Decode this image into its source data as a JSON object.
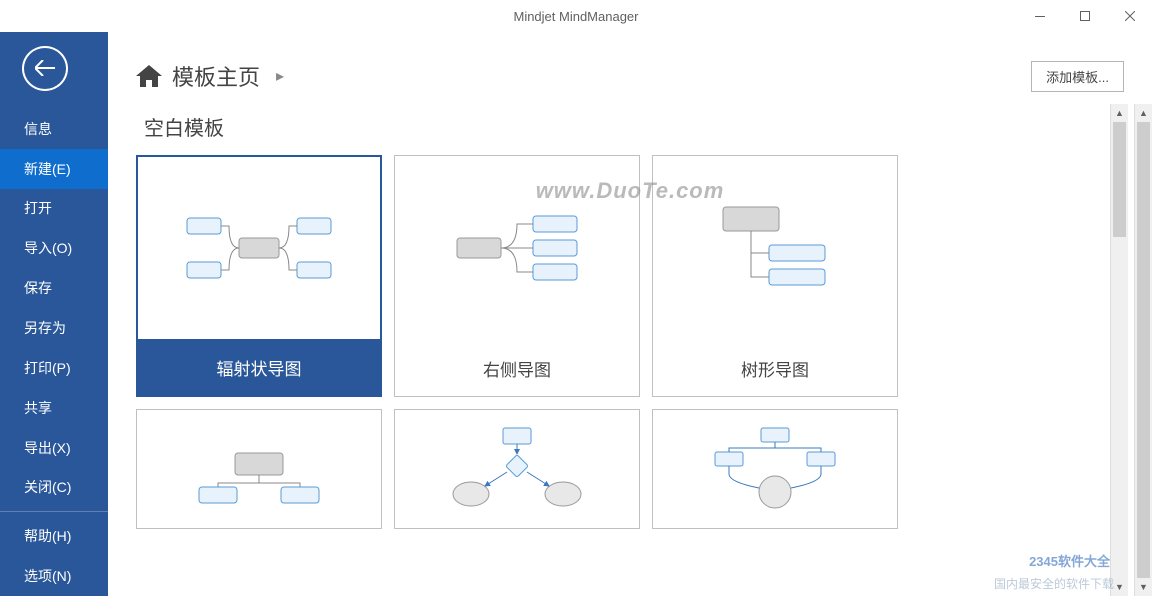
{
  "window": {
    "title": "Mindjet MindManager"
  },
  "sidebar": {
    "items": [
      {
        "label": "信息"
      },
      {
        "label": "新建(E)"
      },
      {
        "label": "打开"
      },
      {
        "label": "导入(O)"
      },
      {
        "label": "保存"
      },
      {
        "label": "另存为"
      },
      {
        "label": "打印(P)"
      },
      {
        "label": "共享"
      },
      {
        "label": "导出(X)"
      },
      {
        "label": "关闭(C)"
      }
    ],
    "bottom_items": [
      {
        "label": "帮助(H)"
      },
      {
        "label": "选项(N)"
      }
    ]
  },
  "header": {
    "breadcrumb_title": "模板主页",
    "add_button": "添加模板..."
  },
  "section": {
    "title": "空白模板"
  },
  "templates": [
    {
      "label": "辐射状导图"
    },
    {
      "label": "右侧导图"
    },
    {
      "label": "树形导图"
    }
  ],
  "watermark": {
    "main": "www.DuoTe.com",
    "logo": "2345软件大全",
    "bottom": "国内最安全的软件下载"
  }
}
